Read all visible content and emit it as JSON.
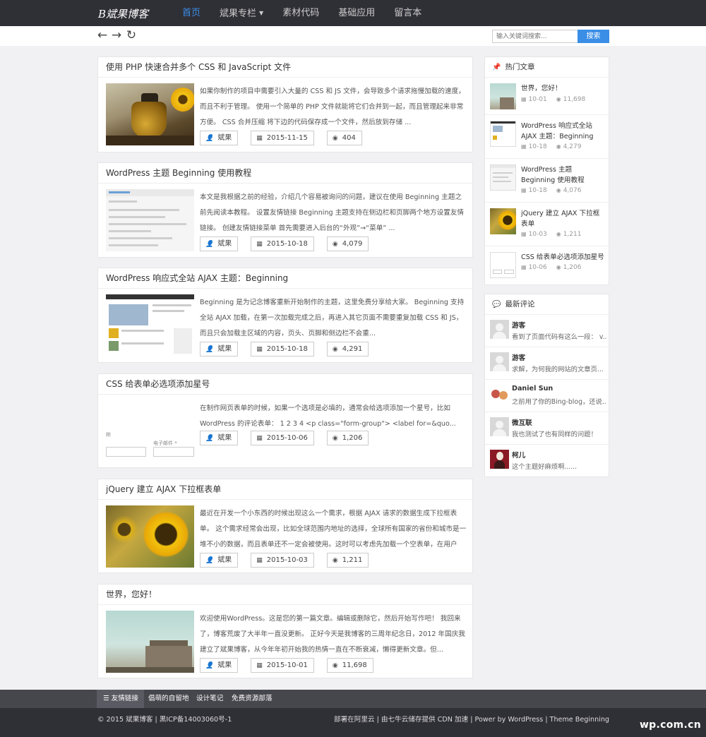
{
  "site": {
    "logo": "B斌果博客"
  },
  "nav": [
    {
      "label": "首页",
      "active": true
    },
    {
      "label": "斌果专栏",
      "dropdown": true
    },
    {
      "label": "素材代码"
    },
    {
      "label": "基础应用"
    },
    {
      "label": "留言本"
    }
  ],
  "toolbar": {
    "back_icon": "←",
    "forward_icon": "→",
    "refresh_icon": "↻",
    "search_placeholder": "输入关键词搜索...",
    "search_button": "搜索"
  },
  "posts": [
    {
      "title": "使用 PHP 快速合并多个 CSS 和 JavaScript 文件",
      "excerpt": "如果你制作的项目中需要引入大量的 CSS 和 JS 文件，会导致多个请求拖慢加载的速度，而且不利于管理。 使用一个简单的 PHP 文件就能将它们合并到一起，而且管理起来非常方便。 CSS 合并压缩 将下边的代码保存成一个文件，然后放到存储 ...",
      "author": "斌果",
      "date": "2015-11-15",
      "views": "404",
      "thumb": "teapot-sunflower"
    },
    {
      "title": "WordPress 主题 Beginning 使用教程",
      "excerpt": "本文是我根据之前的经验，介绍几个容易被询问的问题，建议在使用 Beginning 主题之前先阅读本教程。 设置友情链接 Beginning 主题支持在侧边栏和页脚两个地方设置友情链接。 创建友情链接菜单 首先需要进入后台的“外观”→“菜单” ...",
      "author": "斌果",
      "date": "2015-10-18",
      "views": "4,079",
      "thumb": "admin-screenshot"
    },
    {
      "title": "WordPress 响应式全站 AJAX 主题：Beginning",
      "excerpt": "Beginning 是为记念博客重新开始制作的主题，这里免费分享给大家。 Beginning 支持全站 AJAX 加载，在第一次加载完成之后，再进入其它页面不需要重复加载 CSS 和 JS，而且只会加载主区域的内容，页头、页脚和侧边栏不会重...",
      "author": "斌果",
      "date": "2015-10-18",
      "views": "4,291",
      "thumb": "theme-screenshot"
    },
    {
      "title": "CSS 给表单必选项添加星号",
      "excerpt": "在制作网页表单的时候，如果一个选项是必填的，通常会给选项添加一个星号，比如 WordPress 的评论表单： 1 2 3 4 <p class=\"form-group\"> <label for=&quo...",
      "author": "斌果",
      "date": "2015-10-06",
      "views": "1,206",
      "thumb": "form-screenshot",
      "thumb_text": {
        "a": "称",
        "b": "电子邮件 *"
      }
    },
    {
      "title": "jQuery 建立 AJAX 下拉框表单",
      "excerpt": "最近在开发一个小东西的时候出现这么一个需求，根据 AJAX 请求的数据生成下拉框表单。 这个需求经常会出现，比如全球范围内地址的选择，全球所有国家的省份和城市是一堆不小的数据，而且表单还不一定会被使用。这时可以考虑先加载一个空表单，在用户点...",
      "author": "斌果",
      "date": "2015-10-03",
      "views": "1,211",
      "thumb": "sunflowers"
    },
    {
      "title": "世界，您好！",
      "excerpt": "欢迎使用WordPress。这是您的第一篇文章。编辑或删除它，然后开始写作吧！ 我回来了，博客荒废了大半年一直没更新。 正好今天是我博客的三周年纪念日，2012 年国庆我建立了斌果博客，从今年年初开始我的热情一直在不断衰减，懒得更新文章。但...",
      "author": "斌果",
      "date": "2015-10-01",
      "views": "11,698",
      "thumb": "ruins-sky"
    }
  ],
  "hot": {
    "heading": "热门文章",
    "items": [
      {
        "title": "世界，您好！",
        "date": "10-01",
        "views": "11,698",
        "thumb": "ruins-sky"
      },
      {
        "title": "WordPress 响应式全站 AJAX 主题：Beginning",
        "date": "10-18",
        "views": "4,279",
        "thumb": "theme-screenshot"
      },
      {
        "title": "WordPress 主题 Beginning 使用教程",
        "date": "10-18",
        "views": "4,076",
        "thumb": "admin-screenshot"
      },
      {
        "title": "jQuery 建立 AJAX 下拉框表单",
        "date": "10-03",
        "views": "1,211",
        "thumb": "sunflowers"
      },
      {
        "title": "CSS 给表单必选项添加星号",
        "date": "10-06",
        "views": "1,206",
        "thumb": "form-screenshot"
      }
    ]
  },
  "comments": {
    "heading": "最新评论",
    "items": [
      {
        "name": "游客",
        "text": "看到了页面代码有这么一段： v...",
        "avatar": "default"
      },
      {
        "name": "游客",
        "text": "求解，为何我的网站的文章页...",
        "avatar": "default"
      },
      {
        "name": "Daniel Sun",
        "text": "之前用了你的Bing-blog，还说...",
        "avatar": "cartoon"
      },
      {
        "name": "微互联",
        "text": "我也测试了也有同样的问题！",
        "avatar": "default"
      },
      {
        "name": "柯儿",
        "text": "这个主题好麻烦啊......",
        "avatar": "photo"
      }
    ]
  },
  "footer_links": {
    "heading": "友情链接",
    "items": [
      "倡萌的自留地",
      "设计笔记",
      "免费资源部落"
    ]
  },
  "footer": {
    "copyright": "© 2015 斌果博客 | 黑ICP备14003060号-1",
    "credits": "部署在阿里云 | 由七牛云储存提供 CDN 加速 | Power by WordPress | Theme Beginning"
  },
  "watermark": "wp.com.cn",
  "colors": {
    "accent": "#3a8ee6",
    "topbar": "#2f2f36",
    "footer_links": "#46464d"
  }
}
